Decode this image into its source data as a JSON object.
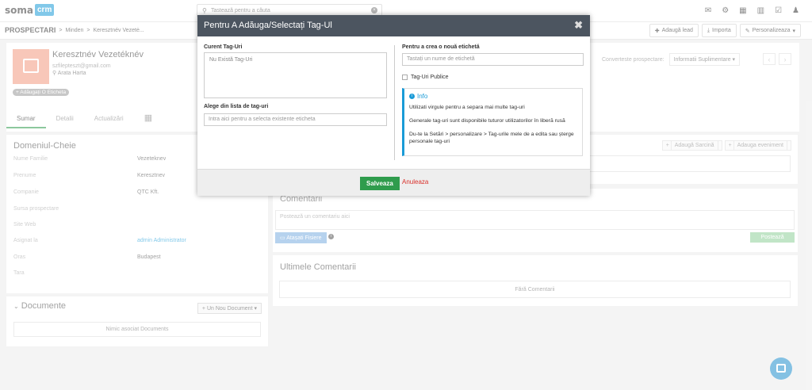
{
  "app": {
    "logo_text": "soma",
    "logo_badge": "crm"
  },
  "search": {
    "placeholder": "Tastează pentru a căuta"
  },
  "top_icons": [
    "envelope-icon",
    "cog-icon",
    "calendar-icon",
    "chart-icon",
    "checkbox-icon",
    "user-icon"
  ],
  "breadcrumb": {
    "root": "PROSPECTARI",
    "sep": ">",
    "item1": "Minden",
    "item2": "Keresztnév Vezetė..."
  },
  "header_actions": {
    "add_lead": "Adaugă lead",
    "import": "Importa",
    "personalize": "Personalizeaza"
  },
  "profile": {
    "name": "Keresztnév Vezetéknév",
    "email": "szfilepteszt@gmail.com",
    "location": "Arata Harta",
    "tag_label": "+ Adăugați O Eticheta"
  },
  "convert": {
    "label": "Converteste prospectare:",
    "select": "Informatii Suplimentare"
  },
  "tabs": [
    "Sumar",
    "Detalii",
    "Actualizări"
  ],
  "details": {
    "title": "Domeniul-Cheie",
    "fields": [
      {
        "label": "Nume Familie",
        "value": "Vezeteknev"
      },
      {
        "label": "Prenume",
        "value": "Keresztnev"
      },
      {
        "label": "Companie",
        "value": "QTC Kft."
      },
      {
        "label": "Sursa prospectare",
        "value": ""
      },
      {
        "label": "Site Web",
        "value": ""
      },
      {
        "label": "Asignat la",
        "value": "admin Administrator"
      },
      {
        "label": "Oras",
        "value": "Budapest"
      },
      {
        "label": "Tara",
        "value": ""
      }
    ]
  },
  "documents": {
    "title": "Documente",
    "new_button": "Un Nou Document",
    "empty": "Nimic asociat Documents"
  },
  "activity_buttons": {
    "add_task": "Adaugă Sarcină",
    "add_event": "Adauga eveniment"
  },
  "comments": {
    "title": "Comentarii",
    "placeholder": "Postează un comentariu aici",
    "attach": "Atașati Fisiere",
    "post": "Postează"
  },
  "last_comments": {
    "title": "Ultimele Comentarii",
    "empty": "Fără Comentarii"
  },
  "modal": {
    "title": "Pentru A Adăuga/Selectați Tag-Ul",
    "current_label": "Curent Tag-Uri",
    "current_empty": "Nu Există Tag-Uri",
    "choose_label": "Alege din lista de tag-uri",
    "choose_placeholder": "Intra aici pentru a selecta existente eticheta",
    "new_label": "Pentru a crea o nouă etichetă",
    "new_placeholder": "Tastați un nume de etichetă",
    "public_label": "Tag-Uri Publice",
    "info_title": "Info",
    "info_lines": [
      "Utilizati virgule pentru a separa mai multe tag-uri",
      "Generale tag-uri sunt disponibile tuturor utilizatorilor în liberă rusă",
      "Du-te la Setări > personalizare > Tag-urile mele de a edita sau șterge personale tag-uri"
    ],
    "save": "Salveaza",
    "cancel": "Anuleaza"
  }
}
